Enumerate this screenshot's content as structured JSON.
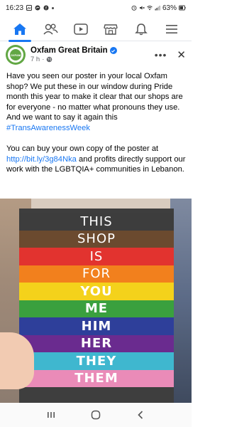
{
  "status_bar": {
    "time": "16:23",
    "battery": "63%"
  },
  "nav": {
    "items": [
      {
        "icon": "home-icon",
        "active": true
      },
      {
        "icon": "friends-icon",
        "active": false
      },
      {
        "icon": "video-icon",
        "active": false
      },
      {
        "icon": "marketplace-icon",
        "active": false
      },
      {
        "icon": "notifications-icon",
        "active": false
      },
      {
        "icon": "menu-icon",
        "active": false
      }
    ]
  },
  "post": {
    "page_name": "Oxfam Great Britain",
    "avatar_text": "OXFAM",
    "time": "7 h",
    "paragraph1": "Have you seen our poster in your local Oxfam shop? We put these in our window during Pride month this year to make it clear that our shops are for everyone - no matter what pronouns they use. And we want to say it again this ",
    "hashtag": "#TransAwarenessWeek",
    "paragraph2_prefix": "You can buy your own copy of the poster at ",
    "link": "http://bit.ly/3g84Nka",
    "paragraph2_suffix": " and profits directly support our work with the LGBTQIA+ communities in Lebanon."
  },
  "poster": {
    "stripes": [
      {
        "text": "THIS",
        "color": "#3d3d3d",
        "bold": false
      },
      {
        "text": "SHOP",
        "color": "#6b4a2f",
        "bold": false
      },
      {
        "text": "IS",
        "color": "#e2332f",
        "bold": false
      },
      {
        "text": "FOR",
        "color": "#f2801d",
        "bold": false
      },
      {
        "text": "YOU",
        "color": "#f4d21b",
        "bold": true
      },
      {
        "text": "ME",
        "color": "#3aa03e",
        "bold": true
      },
      {
        "text": "HIM",
        "color": "#2e3f9a",
        "bold": true
      },
      {
        "text": "HER",
        "color": "#6a2b8f",
        "bold": true
      },
      {
        "text": "THEY",
        "color": "#3fb7cf",
        "bold": true
      },
      {
        "text": "THEM",
        "color": "#ea8bb8",
        "bold": true
      }
    ]
  },
  "colors": {
    "accent": "#1877f2",
    "oxfam_green": "#62a744"
  }
}
